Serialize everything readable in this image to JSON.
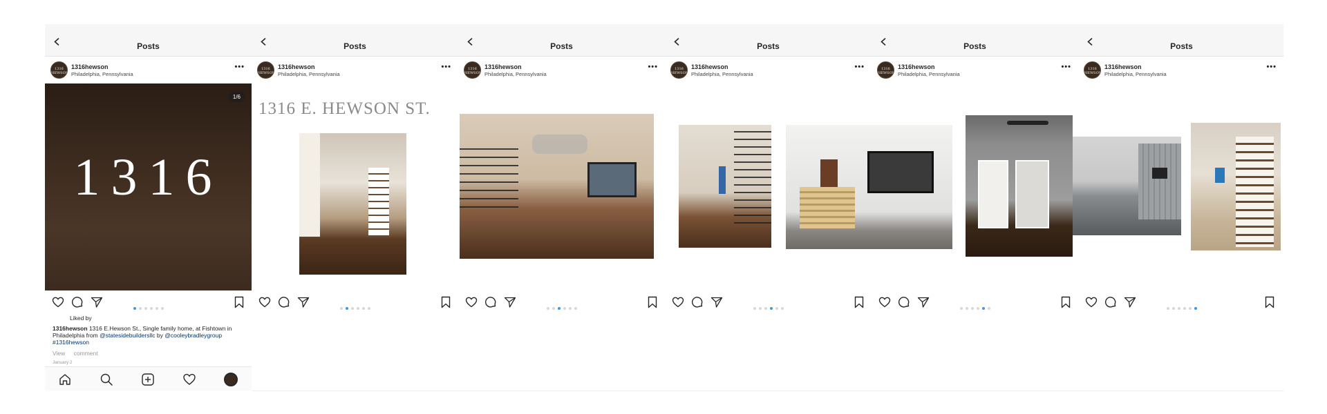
{
  "header": {
    "title": "Posts"
  },
  "account": {
    "username": "1316hewson",
    "location": "Philadelphia, Pennsylvania",
    "avatar_text": "1316 HEWSON"
  },
  "post": {
    "counter": "1/6",
    "slide1_text": "1316",
    "slide2_text": "1316 E. HEWSON ST.",
    "liked_by": "Liked by",
    "caption": {
      "username": "1316hewson",
      "text_before": "1316 E.Hewson St., Single family home, at Fishtown in Philadelphia from",
      "mention1": "@statesidebuildersllc",
      "by_word": "by",
      "mention2": "@cooleybradleygroup",
      "hashtag": "#1316hewson"
    },
    "view_label": "View",
    "comment_label": "comment",
    "date": "January 2"
  },
  "panels": [
    {
      "active_dot": 1
    },
    {
      "active_dot": 2
    },
    {
      "active_dot": 3
    },
    {
      "active_dot": 4
    },
    {
      "active_dot": 5
    },
    {
      "active_dot": 6
    }
  ],
  "icons": {
    "back": "chevron-left-icon",
    "more": "more-icon",
    "like": "heart-icon",
    "comment": "comment-icon",
    "share": "send-icon",
    "save": "bookmark-icon",
    "home": "home-icon",
    "search": "search-icon",
    "add": "add-icon",
    "activity": "heart-icon",
    "profile": "profile-icon"
  },
  "colors": {
    "accent": "#3897f0",
    "link": "#003569",
    "photo_dark": "#3b2a1e"
  }
}
